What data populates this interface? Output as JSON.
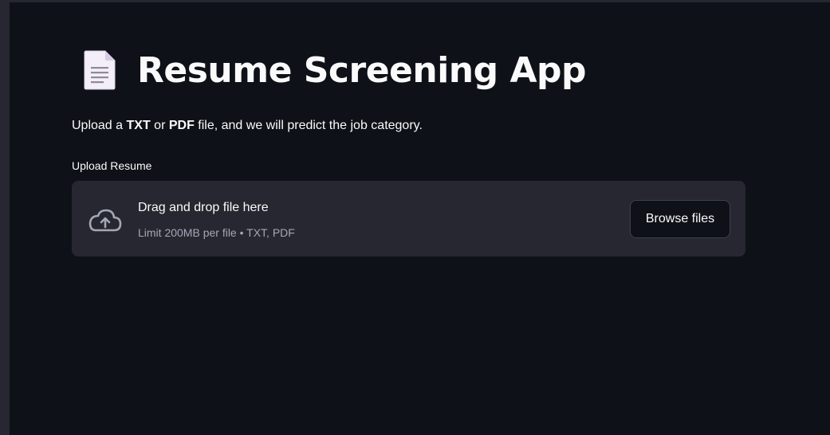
{
  "app": {
    "title": "Resume Screening App",
    "title_icon": "page-facing-up-icon"
  },
  "intro": {
    "prefix": "Upload a ",
    "format1": "TXT",
    "middle": " or ",
    "format2": "PDF",
    "suffix": " file, and we will predict the job category."
  },
  "uploader": {
    "label": "Upload Resume",
    "icon": "cloud-upload-icon",
    "drop_text": "Drag and drop file here",
    "limit_text": "Limit 200MB per file • TXT, PDF",
    "browse_label": "Browse files"
  },
  "colors": {
    "background": "#0e1117",
    "panel": "#262730",
    "text": "#fafafa",
    "muted_text": "#a3a8b8"
  }
}
